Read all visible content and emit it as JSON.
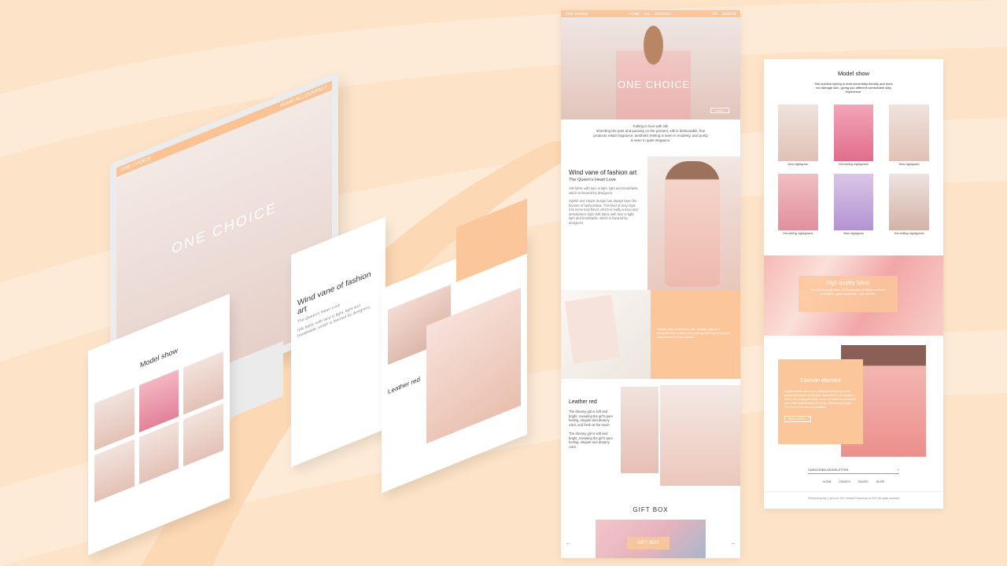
{
  "colors": {
    "accent": "#fbc79a",
    "background": "#fde3c7"
  },
  "brand": "ONE CHOICE",
  "nav": {
    "items": [
      "HOME",
      "ALL",
      "CONTACT"
    ],
    "right_items": [
      "EN",
      "DESIGN"
    ]
  },
  "hero": {
    "title": "ONE CHOICE",
    "button": "MORE >"
  },
  "intro": {
    "heading": "Falling in love with silk",
    "text": "Inheriting the past and passing on the present, silk is fashionable, fine products retain fragrance, aesthetic feeling is seen in modesty, and purity is seen in quiet elegance."
  },
  "wind": {
    "title": "Wind vane of fashion art",
    "subtitle": "The Queen's Heart Love",
    "p1": "Silk fabric with lace is light, light and breathable, which is favored by designers.",
    "p2": "Stylish and simple design has always been the favorite of fashionistas. This kind of sexy style has some lazy flavor, which is really a sexy and atmospheric style.Silk fabric with lace is light, light and breathable, which is favored by designers."
  },
  "gift_row": {
    "text": "Natural silky experience, soft, smooth, light and transparent to create a sexy atmosphere that is elegant temperament of lazy women."
  },
  "leather": {
    "title": "Leather red",
    "p1": "The dreamy girl is soft and bright, revealing the girl's pure feeling, elegant and dreamy color, and fresh at the touch.",
    "p2": "The dreamy girl is soft and bright, revealing the girl's pure feeling, elegant and dreamy color"
  },
  "giftbox": {
    "title": "GIFT BOX",
    "slide_label": "GIFT BOX",
    "prev": "←",
    "next": "→"
  },
  "model_show": {
    "title": "Model show",
    "text": "Silk reactive dyeing is environmentally friendly and does not damage skin, giving you different comfortable silky experience.",
    "items": [
      "New nightgown",
      "Hot-selling nightgowns",
      "New nightgown",
      "Hot-selling nightgowns",
      "New nightgown",
      "Hot-selling nightgowns"
    ]
  },
  "high_quality": {
    "title": "High quality fabric",
    "text": "95.8% belt paper fiber, 4.2% spandex synthetic moisture absorption, good ventilation, high-end silk."
  },
  "fashion": {
    "title": "Fashion element",
    "text": "Gentle bubble sweet color, delicate treatments on all places and facets of Chinese, intellectual in the fashion fabric, the photogenic style, there are sweet and romantic pure white and brearing at it lying, different colors give the user to blow the personalities.",
    "button": "READ MORE >"
  },
  "newsletter": {
    "label": "SUBSCRIBE NEWSLETTER",
    "icon": "+"
  },
  "footer": {
    "links": [
      "HOME",
      "DEMOS",
      "PAGES",
      "SHOP"
    ],
    "copyright": "©Photoshop By Li qi Do in 2017,Adobe Photoshop cc 2017 All rights reserved"
  },
  "left_mock": {
    "monitor_title": "ONE CHOICE",
    "model_title": "Model show",
    "wind_title": "Wind vane of fashion art",
    "leather_title": "Leather red"
  }
}
